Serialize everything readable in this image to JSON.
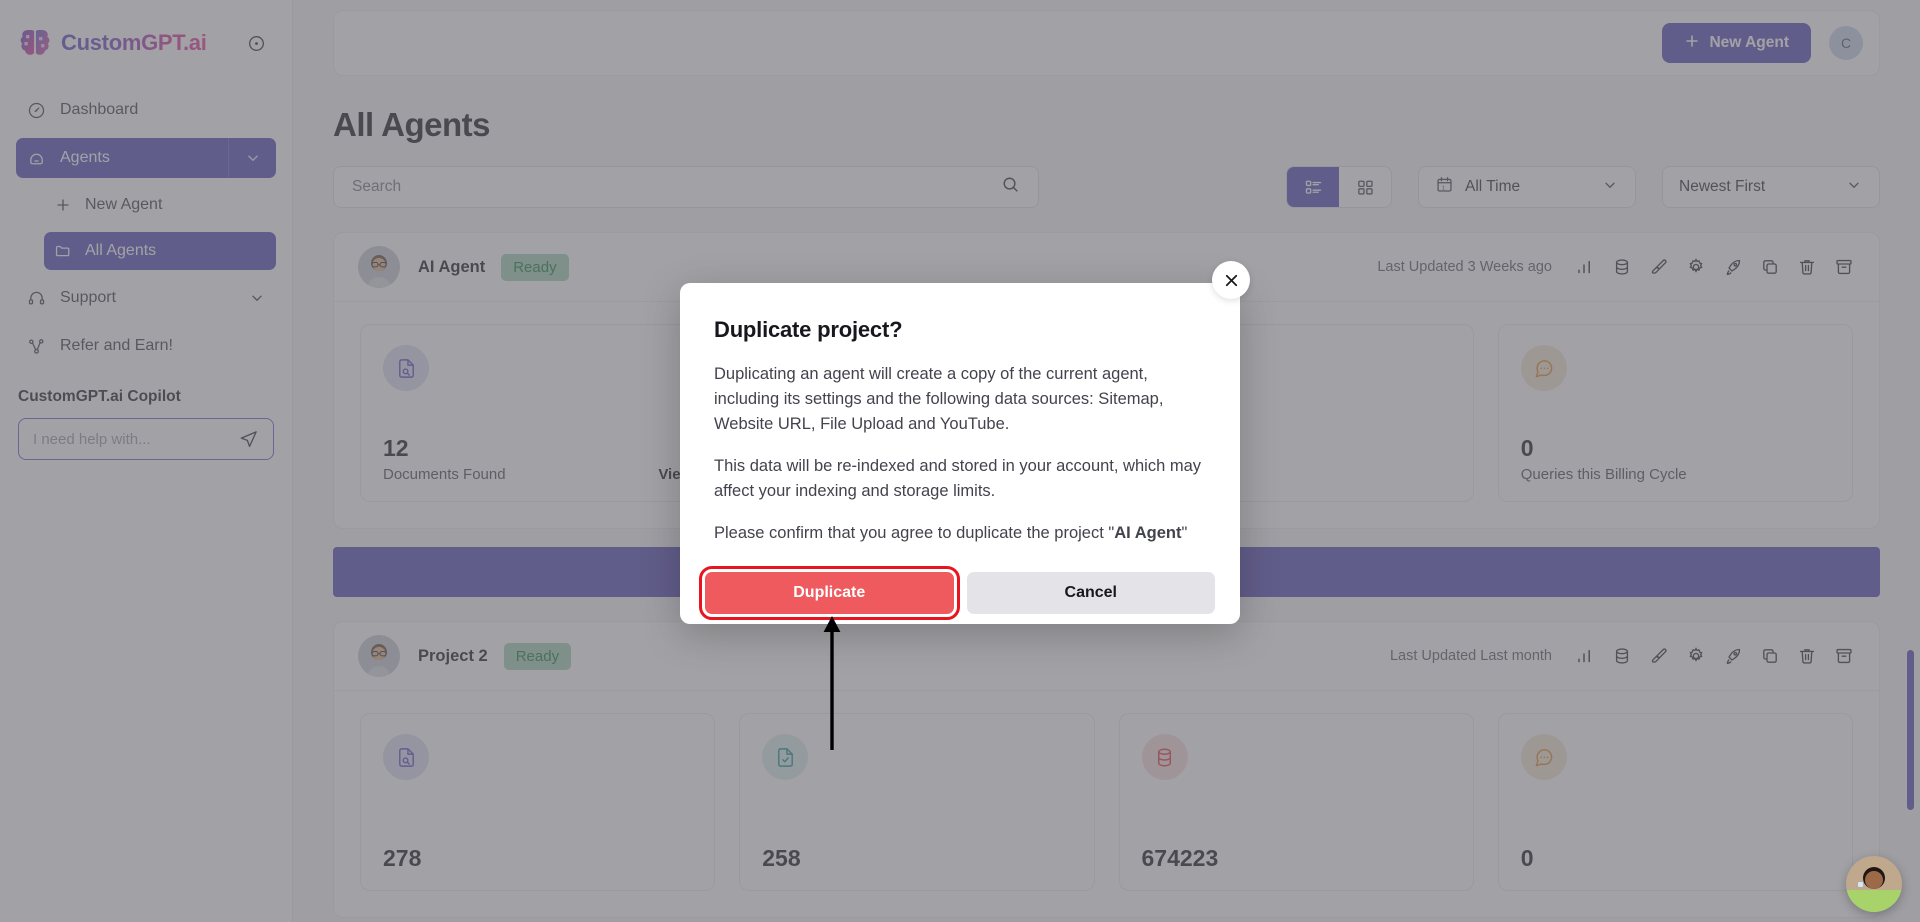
{
  "brand": {
    "name": "CustomGPT.ai",
    "logo_icon": "brain-logo-icon",
    "collapse_icon": "collapse-circle-icon"
  },
  "sidebar": {
    "items": [
      {
        "label": "Dashboard",
        "icon": "gauge-icon",
        "active": false
      },
      {
        "label": "Agents",
        "icon": "agent-home-icon",
        "active": true,
        "has_caret": true
      },
      {
        "label": "New Agent",
        "icon": "plus-icon",
        "active": false
      },
      {
        "label": "All Agents",
        "icon": "folder-icon",
        "active": true
      },
      {
        "label": "Support",
        "icon": "headset-icon",
        "active": false,
        "has_caret": true
      },
      {
        "label": "Refer and Earn!",
        "icon": "share-nodes-icon",
        "active": false
      }
    ],
    "copilot": {
      "title": "CustomGPT.ai Copilot",
      "placeholder": "I need help with...",
      "value": "",
      "send_icon": "send-plane-icon"
    }
  },
  "topbar": {
    "new_agent_label": "New Agent",
    "new_agent_icon": "plus-icon",
    "avatar_initial": "C"
  },
  "page": {
    "title": "All Agents"
  },
  "filters": {
    "search_placeholder": "Search",
    "search_value": "",
    "search_icon": "search-icon",
    "view_list_icon": "list-view-icon",
    "view_grid_icon": "grid-view-icon",
    "view_active": "list",
    "time_filter": {
      "label": "All Time",
      "icon": "calendar-icon",
      "chevron": "chevron-down-icon"
    },
    "sort_filter": {
      "label": "Newest First",
      "chevron": "chevron-down-icon"
    }
  },
  "action_icons": [
    {
      "name": "analytics-bar-chart-icon"
    },
    {
      "name": "database-icon"
    },
    {
      "name": "paintbrush-icon"
    },
    {
      "name": "gear-icon"
    },
    {
      "name": "rocket-icon"
    },
    {
      "name": "duplicate-copy-icon"
    },
    {
      "name": "trash-icon"
    },
    {
      "name": "archive-icon"
    }
  ],
  "agents": [
    {
      "name": "AI Agent",
      "status": "Ready",
      "last_updated": "Last Updated 3 Weeks ago",
      "stats": [
        {
          "value": "12",
          "label": "Documents Found",
          "link": "View",
          "icon": "document-search-icon",
          "color": "#5b4bc4",
          "bg": "#ddd9f2"
        },
        {
          "value": "",
          "label": "",
          "link": "",
          "icon": "document-check-icon",
          "color": "#1f8f8f",
          "bg": "#d9ecec"
        },
        {
          "value": "",
          "label": "",
          "link": "",
          "icon": "database-icon",
          "color": "#e0383f",
          "bg": "#f6dcdd"
        },
        {
          "value": "0",
          "label": "Queries this Billing Cycle",
          "link": "",
          "icon": "chat-bubble-dots-icon",
          "color": "#e08928",
          "bg": "#f5e5d2"
        }
      ]
    },
    {
      "name": "Project 2",
      "status": "Ready",
      "last_updated": "Last Updated Last month",
      "stats": [
        {
          "value": "278",
          "label": "",
          "link": "",
          "icon": "document-search-icon",
          "color": "#5b4bc4",
          "bg": "#ddd9f2"
        },
        {
          "value": "258",
          "label": "",
          "link": "",
          "icon": "document-check-icon",
          "color": "#1f8f8f",
          "bg": "#d9ecec"
        },
        {
          "value": "674223",
          "label": "",
          "link": "",
          "icon": "database-icon",
          "color": "#e0383f",
          "bg": "#f6dcdd"
        },
        {
          "value": "0",
          "label": "",
          "link": "",
          "icon": "chat-bubble-dots-icon",
          "color": "#e08928",
          "bg": "#f5e5d2"
        }
      ]
    }
  ],
  "modal": {
    "title": "Duplicate project?",
    "close_icon": "close-x-icon",
    "paragraph_1": "Duplicating an agent will create a copy of the current agent, including its settings and the following data sources: Sitemap, Website URL, File Upload and YouTube.",
    "paragraph_2": "This data will be re-indexed and stored in your account, which may affect your indexing and storage limits.",
    "paragraph_3_prefix": "Please confirm that you agree to duplicate the project \"",
    "paragraph_3_project": "AI Agent",
    "paragraph_3_suffix": "\"",
    "confirm_label": "Duplicate",
    "cancel_label": "Cancel",
    "confirm_color": "#ee5a5e",
    "highlight_color": "#e8141e"
  },
  "annotation": {
    "arrow_name": "callout-arrow-to-duplicate-button",
    "color": "#000000"
  },
  "chat_widget": {
    "name": "support-chat-avatar"
  },
  "colors": {
    "accent": "#554ab5",
    "ready_badge_bg": "#a4ceb3",
    "ready_badge_text": "#18803f",
    "scrollbar": "#554ab5"
  }
}
